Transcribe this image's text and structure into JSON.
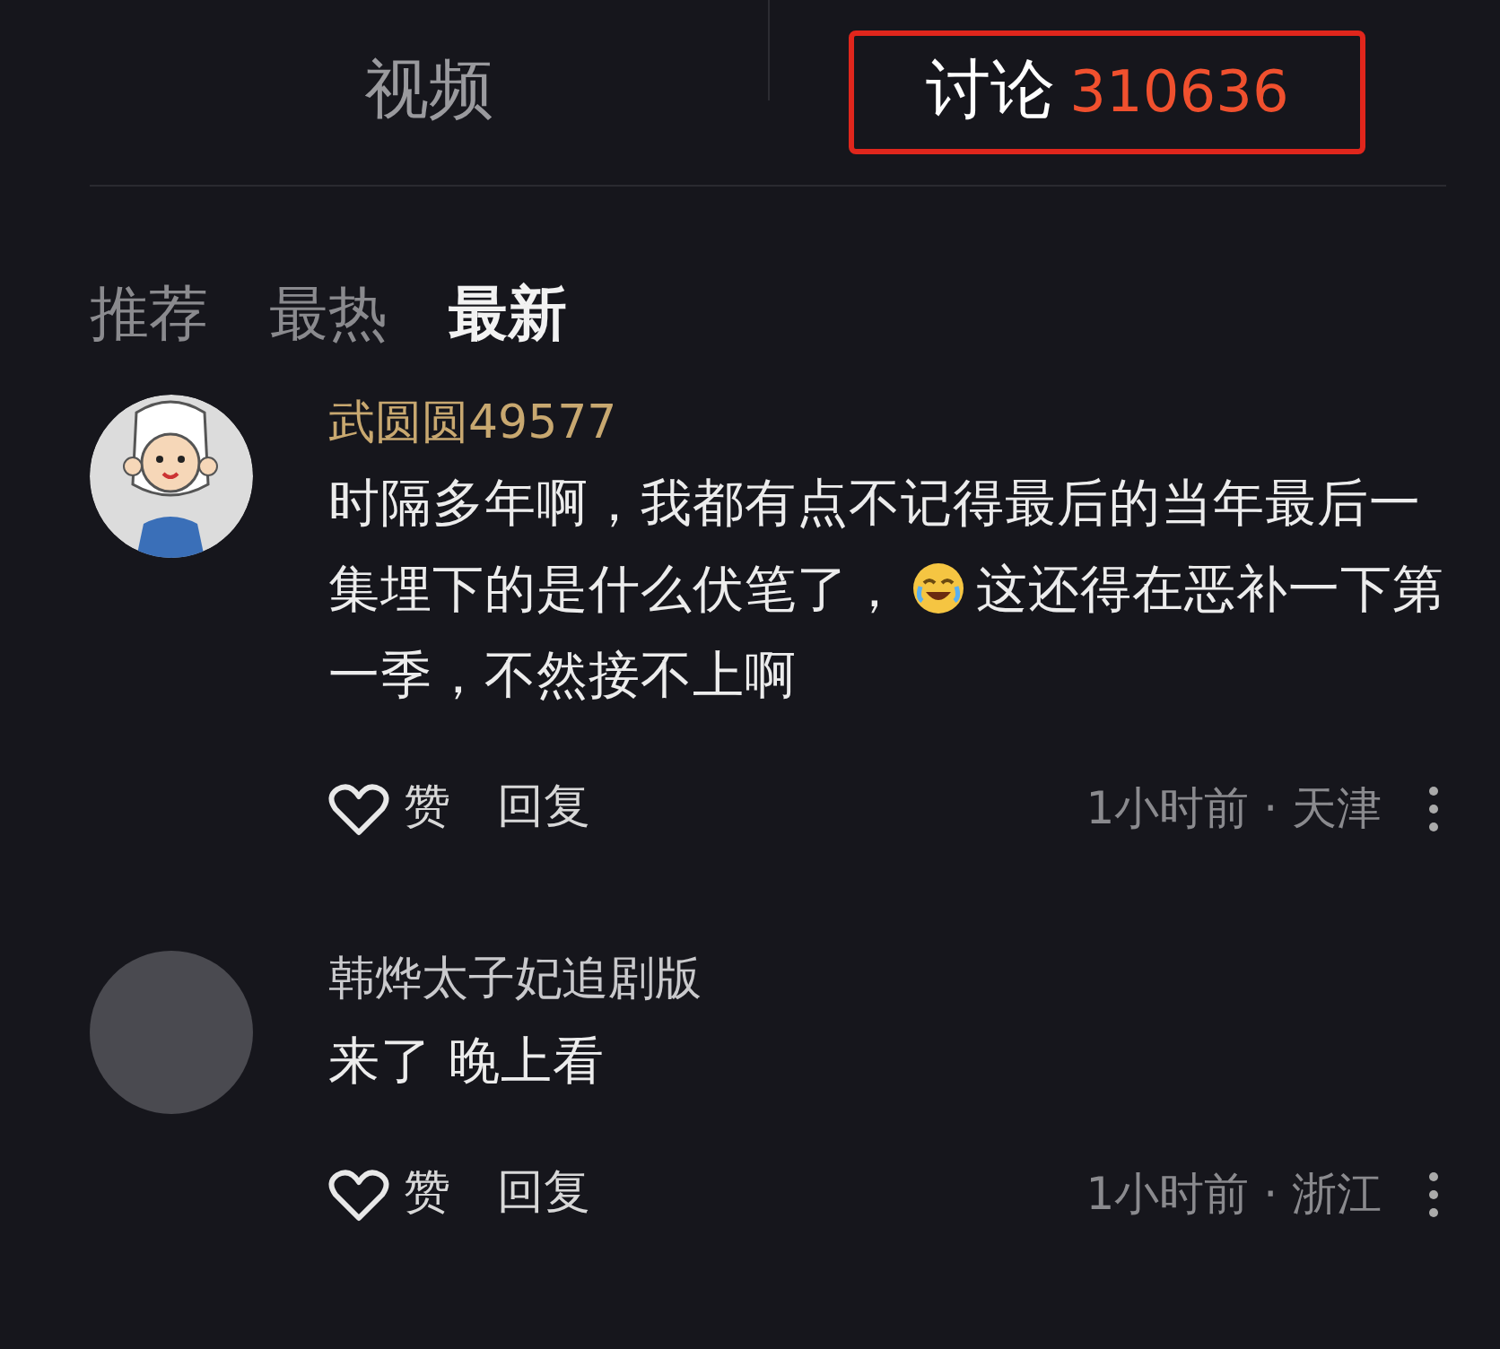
{
  "tabs": [
    {
      "label": "视频",
      "selected": false,
      "outlined": false
    },
    {
      "label": "讨论",
      "count": "310636",
      "selected": true,
      "outlined": true
    }
  ],
  "sort_tabs": [
    {
      "label": "推荐",
      "selected": false
    },
    {
      "label": "最热",
      "selected": false
    },
    {
      "label": "最新",
      "selected": true
    }
  ],
  "comments": [
    {
      "kind": "cartoon-avatar",
      "username": "武圆圆49577",
      "segments": [
        {
          "kind": "text",
          "text": "时隔多年啊，我都有点不记得最后的当年最后一集埋下的是什么伏笔了，"
        },
        {
          "kind": "emoji"
        },
        {
          "kind": "text",
          "text": "这还得在恶补一下第一季，不然接不上啊"
        }
      ],
      "like_label": "赞",
      "reply_label": "回复",
      "meta": "1小时前 · 天津"
    },
    {
      "kind": "photo-avatar",
      "username": "韩烨太子妃追剧版",
      "segments": [
        {
          "kind": "text",
          "text": "来了 晚上看"
        }
      ],
      "like_label": "赞",
      "reply_label": "回复",
      "meta": "1小时前 · 浙江"
    }
  ]
}
